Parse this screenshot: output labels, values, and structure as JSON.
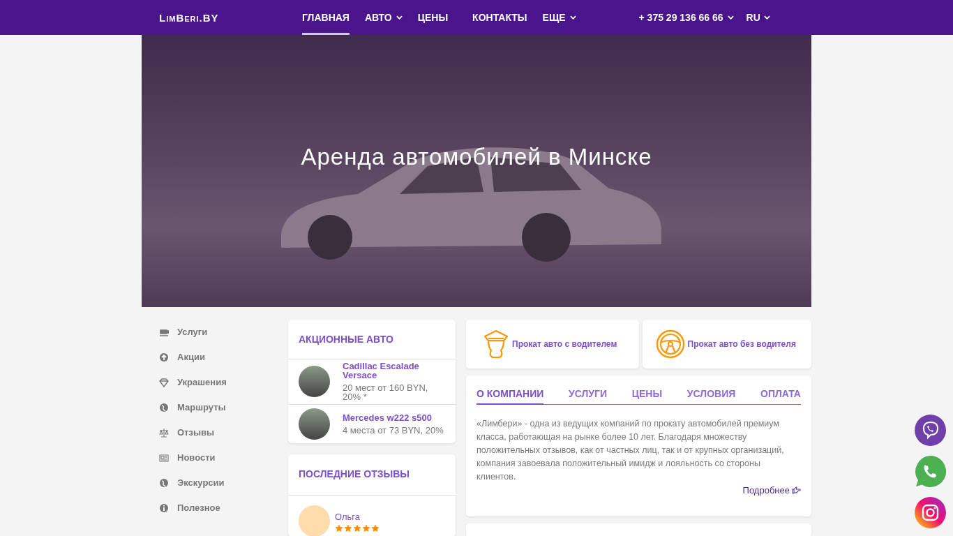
{
  "header": {
    "logo": "LimBeri.BY",
    "nav": [
      {
        "label": "ГЛАВНАЯ",
        "selected": true,
        "dropdown": false
      },
      {
        "label": "АВТО",
        "selected": false,
        "dropdown": true
      },
      {
        "label": "ЦЕНЫ",
        "selected": false,
        "dropdown": false
      },
      {
        "label": "КОНТАКТЫ",
        "selected": false,
        "dropdown": false
      },
      {
        "label": "ЕЩЕ",
        "selected": false,
        "dropdown": true
      }
    ],
    "phone": "+ 375 29 136 66 66",
    "language": "RU"
  },
  "hero": {
    "title": "Аренда автомобилей в Минске"
  },
  "sidebar": {
    "items": [
      "Услуги",
      "Акции",
      "Украшения",
      "Маршруты",
      "Отзывы",
      "Новости",
      "Экскурсии",
      "Полезное"
    ]
  },
  "promo_cars": {
    "title": "АКЦИОННЫЕ АВТО",
    "items": [
      {
        "name": "Cadillac Escalade Versace",
        "details": "20 мест от 160 BYN, 20% *"
      },
      {
        "name": "Mercedes w222 s500",
        "details": "4 места от 73 BYN, 20%"
      }
    ]
  },
  "reviews": {
    "title": "ПОСЛЕДНИЕ ОТЗЫВЫ",
    "items": [
      {
        "author": "Ольга",
        "stars": 5
      }
    ]
  },
  "services": [
    "Прокат авто с водителем",
    "Прокат авто без водителя"
  ],
  "about": {
    "tabs": [
      {
        "label": "О КОМПАНИИ",
        "selected": true
      },
      {
        "label": "УСЛУГИ",
        "selected": false
      },
      {
        "label": "ЦЕНЫ",
        "selected": false
      },
      {
        "label": "УСЛОВИЯ",
        "selected": false
      },
      {
        "label": "ОПЛАТА",
        "selected": false
      }
    ],
    "text": "«Лимбери» - одна из ведущих компаний по прокату автомобилей премиум класса, работающая на рынке более 10 лет. Благодаря множеству положительных отзывов, как от частных лиц, так и от крупных организаций, компания завоевала положительный имидж и лояльность со стороны клиентов.",
    "more_link": "Подробнее"
  }
}
